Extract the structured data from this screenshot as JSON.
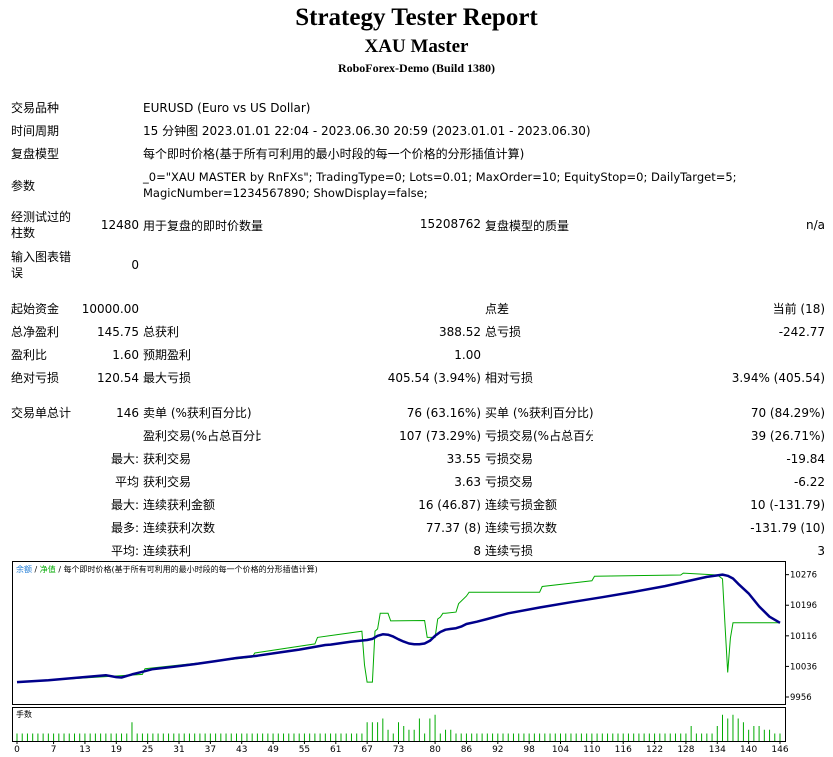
{
  "header": {
    "title": "Strategy Tester Report",
    "ea_name": "XAU Master",
    "server": "RoboForex-Demo (Build 1380)"
  },
  "settings": {
    "symbol_label": "交易品种",
    "symbol": "EURUSD (Euro vs US Dollar)",
    "period_label": "时间周期",
    "period": "15 分钟图 2023.01.01 22:04 - 2023.06.30 20:59 (2023.01.01 - 2023.06.30)",
    "model_label": "复盘模型",
    "model": "每个即时价格(基于所有可利用的最小时段的每一个价格的分形插值计算)",
    "params_label": "参数",
    "params": "_0=\"XAU MASTER by RnFXs\"; TradingType=0; Lots=0.01; MaxOrder=10; EquityStop=0; DailyTarget=5; MagicNumber=1234567890; ShowDisplay=false;",
    "bars_label": "经测试过的柱数",
    "bars": "12480",
    "ticks_label": "用于复盘的即时价数量",
    "ticks": "15208762",
    "quality_label": "复盘模型的质量",
    "quality": "n/a",
    "errors_label": "输入图表错误",
    "errors": "0"
  },
  "stats": {
    "initial_deposit_label": "起始资金",
    "initial_deposit": "10000.00",
    "spread_label": "点差",
    "spread": "当前 (18)",
    "net_profit_label": "总净盈利",
    "net_profit": "145.75",
    "gross_profit_label": "总获利",
    "gross_profit": "388.52",
    "gross_loss_label": "总亏损",
    "gross_loss": "-242.77",
    "profit_factor_label": "盈利比",
    "profit_factor": "1.60",
    "expected_payoff_label": "预期盈利",
    "expected_payoff": "1.00",
    "abs_drawdown_label": "绝对亏损",
    "abs_drawdown": "120.54",
    "max_drawdown_label": "最大亏损",
    "max_drawdown": "405.54 (3.94%)",
    "rel_drawdown_label": "相对亏损",
    "rel_drawdown": "3.94% (405.54)",
    "total_trades_label": "交易单总计",
    "total_trades": "146",
    "short_label": "卖单 (%获利百分比)",
    "short": "76 (63.16%)",
    "long_label": "买单 (%获利百分比)",
    "long": "70 (84.29%)",
    "profit_trades_label": "盈利交易(%占总百分比)",
    "profit_trades": "107 (73.29%)",
    "loss_trades_label": "亏损交易(%占总百分比)",
    "loss_trades": "39 (26.71%)",
    "largest_label": "最大:",
    "largest_profit_label": "获利交易",
    "largest_profit": "33.55",
    "largest_loss_label": "亏损交易",
    "largest_loss": "-19.84",
    "average_label": "平均",
    "average_profit_label": "获利交易",
    "average_profit": "3.63",
    "average_loss_label": "亏损交易",
    "average_loss": "-6.22",
    "max_label": "最大:",
    "max_cons_wins_label": "连续获利金额",
    "max_cons_wins": "16 (46.87)",
    "max_cons_losses_label": "连续亏损金额",
    "max_cons_losses": "10 (-131.79)",
    "most_label": "最多:",
    "max_cons_profit_label": "连续获利次数",
    "max_cons_profit": "77.37 (8)",
    "max_cons_loss_label": "连续亏损次数",
    "max_cons_loss": "-131.79 (10)",
    "avg_label": "平均:",
    "avg_cons_wins_label": "连续获利",
    "avg_cons_wins": "8",
    "avg_cons_losses_label": "连续亏损",
    "avg_cons_losses": "3"
  },
  "chart_data": {
    "type": "line",
    "legend_text": [
      "余额",
      " / ",
      "净值",
      " / 每个即时价格(基于所有可利用的最小时段的每一个价格的分形插值计算)"
    ],
    "volume_label": "手数",
    "colors": {
      "balance": "#00008b",
      "equity": "#00aa00",
      "volume": "#00aa00",
      "legend_balance": "#1e7bd6",
      "legend_equity": "#00aa00"
    },
    "yticks": [
      10276,
      10196,
      10116,
      10036,
      9956
    ],
    "ylim": [
      9956,
      10296
    ],
    "xticks": [
      0,
      7,
      13,
      19,
      25,
      31,
      37,
      43,
      49,
      55,
      61,
      67,
      73,
      80,
      86,
      92,
      98,
      104,
      110,
      116,
      122,
      128,
      134,
      140,
      146
    ],
    "xlim": [
      0,
      146
    ],
    "series": [
      {
        "x": [
          0,
          6,
          12,
          17,
          19,
          20,
          22,
          24,
          26,
          30,
          34,
          38,
          42,
          46,
          50,
          54,
          57,
          59,
          60,
          62,
          64,
          67,
          68,
          69,
          70,
          71,
          72,
          73,
          74,
          75,
          76,
          77,
          78,
          79,
          80,
          81,
          82,
          83,
          84,
          85,
          86,
          88,
          90,
          94,
          100,
          106,
          112,
          118,
          124,
          128,
          132,
          134,
          135,
          136,
          137,
          138,
          140,
          142,
          144,
          146
        ],
        "y": [
          9995,
          10000,
          10007,
          10013,
          10008,
          10007,
          10015,
          10022,
          10029,
          10035,
          10042,
          10050,
          10058,
          10064,
          10072,
          10080,
          10087,
          10092,
          10093,
          10097,
          10101,
          10105,
          10108,
          10116,
          10120,
          10119,
          10114,
          10107,
          10101,
          10096,
          10094,
          10094,
          10096,
          10103,
          10116,
          10126,
          10132,
          10134,
          10136,
          10140,
          10147,
          10153,
          10160,
          10175,
          10190,
          10204,
          10217,
          10231,
          10246,
          10258,
          10270,
          10274,
          10276,
          10273,
          10266,
          10252,
          10227,
          10193,
          10166,
          10150
        ]
      },
      {
        "x": [
          0,
          24,
          24.5,
          45,
          45.5,
          57,
          57.5,
          66,
          66.5,
          67,
          68,
          68.5,
          69,
          69.5,
          71,
          71.5,
          78,
          78.5,
          80,
          80.5,
          81,
          81.5,
          82,
          84,
          84.5,
          86,
          86.5,
          100,
          100.5,
          110,
          110.5,
          127,
          127.5,
          134,
          135,
          135.5,
          136,
          136.5,
          137,
          140,
          146
        ],
        "y": [
          9995,
          10015,
          10030,
          10060,
          10071,
          10095,
          10112,
          10128,
          10040,
          9995,
          9995,
          10128,
          10134,
          10175,
          10175,
          10155,
          10156,
          10112,
          10112,
          10160,
          10165,
          10175,
          10175,
          10178,
          10200,
          10220,
          10230,
          10230,
          10245,
          10260,
          10272,
          10275,
          10280,
          10275,
          10265,
          10140,
          10020,
          10110,
          10150,
          10150,
          10150
        ]
      }
    ],
    "volume": [
      2,
      2,
      2,
      2,
      2,
      2,
      2,
      2,
      2,
      2,
      2,
      2,
      2,
      2,
      2,
      2,
      2,
      2,
      2,
      2,
      2,
      2,
      5,
      2,
      2,
      2,
      2,
      2,
      2,
      2,
      2,
      2,
      2,
      2,
      2,
      2,
      2,
      2,
      2,
      2,
      2,
      2,
      2,
      2,
      2,
      2,
      2,
      2,
      2,
      2,
      2,
      2,
      2,
      2,
      2,
      2,
      2,
      2,
      2,
      2,
      2,
      2,
      2,
      2,
      2,
      2,
      2,
      5,
      5,
      5,
      6,
      3,
      2,
      5,
      4,
      3,
      3,
      6,
      2,
      6,
      7,
      2,
      3,
      3,
      2,
      2,
      2,
      2,
      2,
      2,
      2,
      2,
      2,
      2,
      2,
      2,
      2,
      2,
      2,
      2,
      2,
      2,
      2,
      2,
      2,
      2,
      2,
      2,
      2,
      2,
      2,
      2,
      2,
      2,
      2,
      2,
      2,
      2,
      2,
      2,
      2,
      2,
      2,
      2,
      2,
      2,
      2,
      2,
      2,
      4,
      2,
      2,
      2,
      2,
      4,
      7,
      6,
      7,
      6,
      5,
      3,
      4,
      4,
      3,
      3,
      2,
      2
    ]
  }
}
